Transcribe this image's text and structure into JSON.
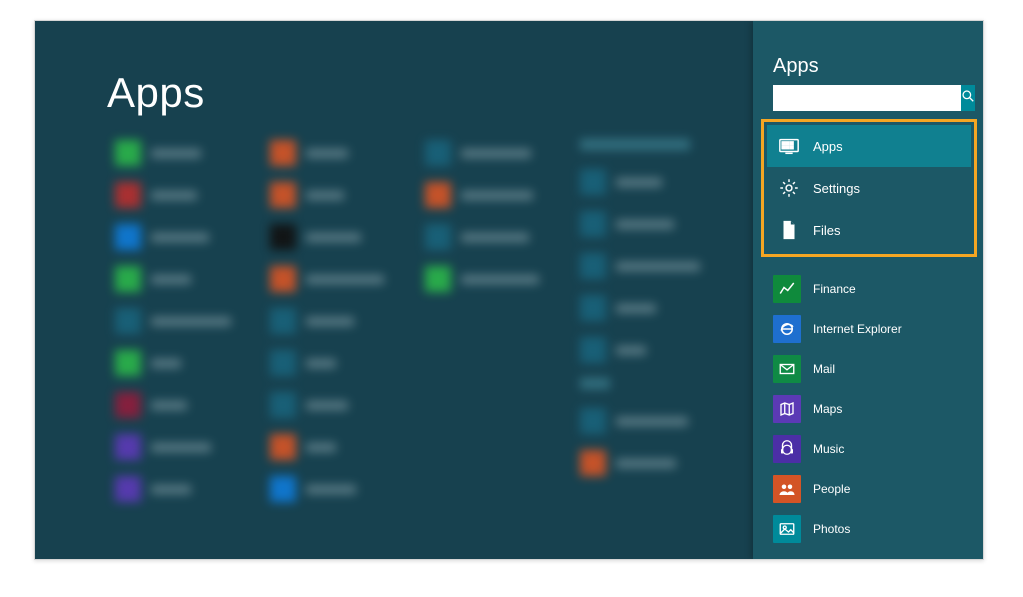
{
  "apps_screen": {
    "title": "Apps"
  },
  "charm": {
    "title": "Apps",
    "search": {
      "value": "",
      "placeholder": ""
    },
    "scopes": [
      {
        "id": "apps",
        "label": "Apps",
        "icon": "apps-icon",
        "selected": true
      },
      {
        "id": "settings",
        "label": "Settings",
        "icon": "settings-icon",
        "selected": false
      },
      {
        "id": "files",
        "label": "Files",
        "icon": "files-icon",
        "selected": false
      }
    ],
    "results": [
      {
        "id": "finance",
        "label": "Finance",
        "icon": "finance-icon",
        "color": "#0f8a3c"
      },
      {
        "id": "ie",
        "label": "Internet Explorer",
        "icon": "ie-icon",
        "color": "#1e6fcf"
      },
      {
        "id": "mail",
        "label": "Mail",
        "icon": "mail-icon",
        "color": "#0f8a45"
      },
      {
        "id": "maps",
        "label": "Maps",
        "icon": "maps-icon",
        "color": "#5b3ab5"
      },
      {
        "id": "music",
        "label": "Music",
        "icon": "music-icon",
        "color": "#4b2fa6"
      },
      {
        "id": "people",
        "label": "People",
        "icon": "people-icon",
        "color": "#d35426"
      },
      {
        "id": "photos",
        "label": "Photos",
        "icon": "photos-icon",
        "color": "#008a9a"
      }
    ]
  },
  "colors": {
    "panel_bg": "#1c5866",
    "main_bg": "#17414f",
    "accent": "#008a9a",
    "highlight_border": "#f5a623",
    "selected_scope": "#108090"
  }
}
